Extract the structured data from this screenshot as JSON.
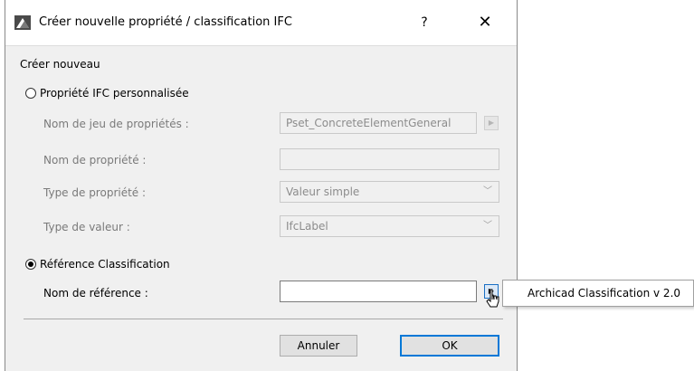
{
  "window": {
    "title": "Créer nouvelle propriété / classification IFC",
    "help_label": "?",
    "close_label": "✕"
  },
  "section_label": "Créer nouveau",
  "custom_property": {
    "radio_label": "Propriété IFC personnalisée",
    "selected": false,
    "pset_label": "Nom de jeu de propriétés :",
    "pset_value": "Pset_ConcreteElementGeneral",
    "property_name_label": "Nom de propriété :",
    "property_name_value": "",
    "property_type_label": "Type de propriété :",
    "property_type_value": "Valeur simple",
    "value_type_label": "Type de valeur :",
    "value_type_value": "IfcLabel"
  },
  "classification": {
    "radio_label": "Référence Classification",
    "selected": true,
    "reference_name_label": "Nom de référence :",
    "reference_name_value": ""
  },
  "buttons": {
    "cancel_label": "Annuler",
    "ok_label": "OK"
  },
  "popup_menu": {
    "items": [
      "Archicad Classification v 2.0"
    ]
  },
  "colors": {
    "dialog_bg": "#f0f0f0",
    "default_button_border": "#0078d7",
    "disabled_text": "#7a7a7a"
  }
}
